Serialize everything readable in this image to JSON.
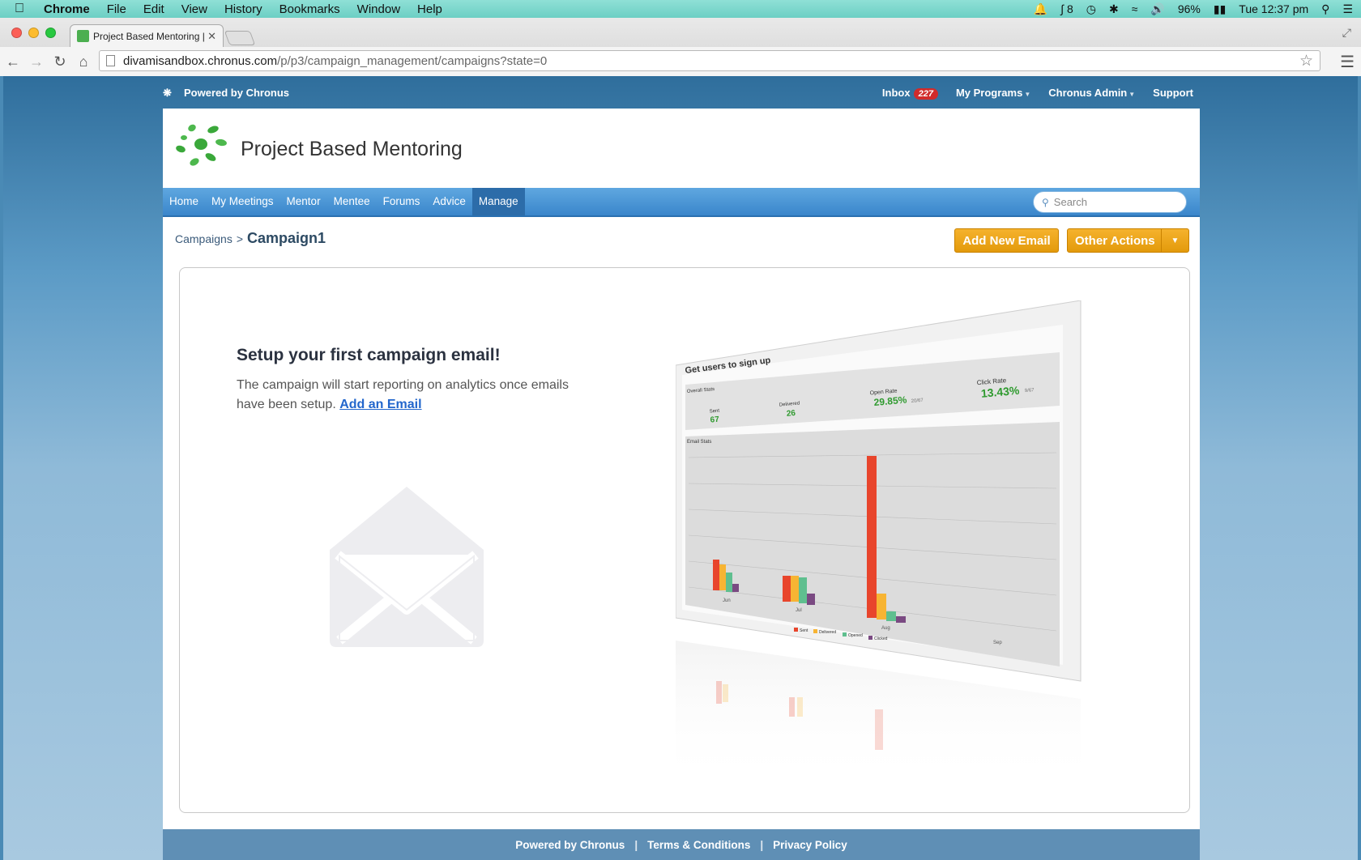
{
  "menubar": {
    "app": "Chrome",
    "items": [
      "File",
      "Edit",
      "View",
      "History",
      "Bookmarks",
      "Window",
      "Help"
    ],
    "status_count": "8",
    "battery": "96%",
    "clock": "Tue 12:37 pm"
  },
  "browser": {
    "tab_title": "Project Based Mentoring | ",
    "url_host": "divamisandbox.chronus.com",
    "url_path": "/p/p3/campaign_management/campaigns?state=0"
  },
  "sitebar": {
    "powered_by": "Powered by Chronus",
    "inbox_label": "Inbox",
    "inbox_count": "227",
    "my_programs": "My Programs",
    "admin": "Chronus Admin",
    "support": "Support"
  },
  "header": {
    "title": "Project Based Mentoring"
  },
  "nav": {
    "items": [
      "Home",
      "My Meetings",
      "Mentor",
      "Mentee",
      "Forums",
      "Advice",
      "Manage"
    ],
    "active": "Manage",
    "search_placeholder": "Search"
  },
  "page": {
    "breadcrumb_parent": "Campaigns",
    "breadcrumb_sep": ">",
    "breadcrumb_current": "Campaign1",
    "add_email_button": "Add New Email",
    "other_actions_button": "Other Actions"
  },
  "empty_state": {
    "heading": "Setup your first campaign email!",
    "description": "The campaign will start reporting on analytics once emails have been setup.",
    "link": "Add an Email"
  },
  "preview": {
    "title": "Get users to sign up",
    "overall": "Overall Stats",
    "stats": [
      {
        "label": "Sent",
        "value": "67"
      },
      {
        "label": "Delivered",
        "value": "26"
      },
      {
        "label": "Open Rate",
        "value": "29.85%",
        "sub": "20/67"
      },
      {
        "label": "Click Rate",
        "value": "13.43%",
        "sub": "9/67"
      }
    ],
    "email_stats": "Email Stats",
    "months": [
      "Jun",
      "Jul",
      "Aug",
      "Sep"
    ],
    "legend": [
      "Sent",
      "Delivered",
      "Opened",
      "Clicked"
    ],
    "colors": {
      "sent": "#e8452c",
      "delivered": "#f7b433",
      "opened": "#5fbf8f",
      "clicked": "#7a4a82",
      "stat_green": "#2f9a2f"
    }
  },
  "footer": {
    "powered_by": "Powered by Chronus",
    "terms": "Terms & Conditions",
    "privacy": "Privacy Policy"
  }
}
